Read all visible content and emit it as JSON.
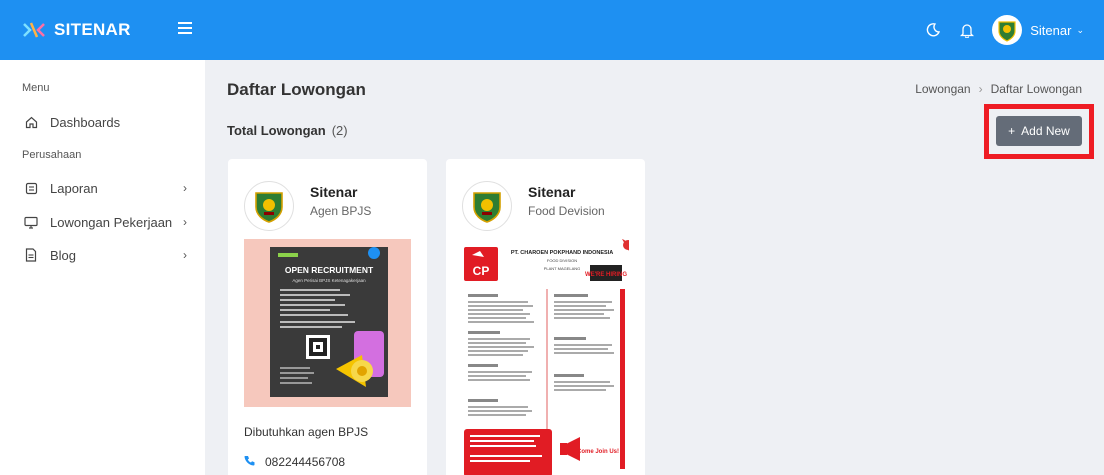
{
  "app": {
    "name": "SITENAR"
  },
  "topbar": {
    "user_name": "Sitenar",
    "user_caret": "⌄"
  },
  "sidebar": {
    "section_menu": "Menu",
    "section_company": "Perusahaan",
    "items": [
      {
        "label": "Dashboards"
      },
      {
        "label": "Laporan",
        "chevron": "›"
      },
      {
        "label": "Lowongan Pekerjaan",
        "chevron": "›"
      },
      {
        "label": "Blog",
        "chevron": "›"
      }
    ]
  },
  "page": {
    "title": "Daftar Lowongan",
    "breadcrumb": [
      "Lowongan",
      "Daftar Lowongan"
    ],
    "breadcrumb_sep": "›",
    "total_label": "Total Lowongan",
    "total_count": "(2)",
    "add_button": "Add New",
    "add_plus": "+"
  },
  "cards": [
    {
      "company": "Sitenar",
      "position": "Agen BPJS",
      "description": "Dibutuhkan agen BPJS",
      "phone": "082244456708",
      "poster": {
        "heading": "OPEN RECRUITMENT",
        "subheading": "Agen Perisai BPJS Ketenagakerjaan"
      }
    },
    {
      "company": "Sitenar",
      "position": "Food Devision",
      "poster": {
        "company": "PT. CHAROEN POKPHAND INDONESIA",
        "division": "FOOD DIVISION",
        "plant": "PLANT MAGELANG",
        "logo": "CP",
        "badge": "WE'RE HIRING",
        "cta": "Come Join Us!"
      }
    }
  ],
  "colors": {
    "primary": "#1e90f2",
    "highlight": "#ee1c24",
    "button": "#646c78"
  }
}
